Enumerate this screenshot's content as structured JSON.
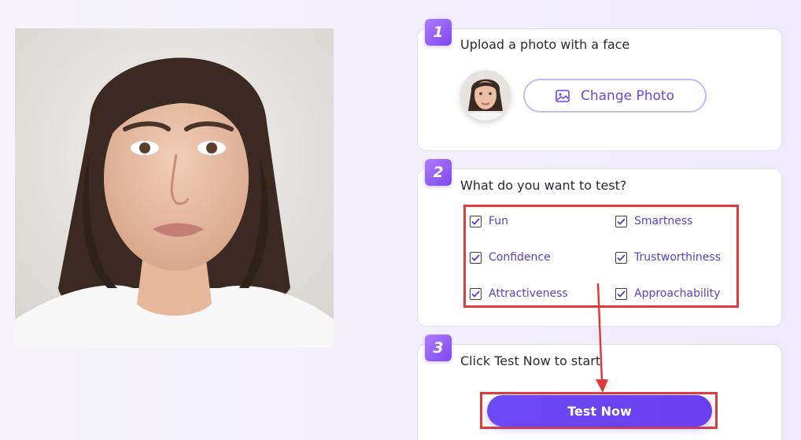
{
  "steps": [
    {
      "number": "1",
      "title": "Upload a photo with a face"
    },
    {
      "number": "2",
      "title": "What do you want to test?"
    },
    {
      "number": "3",
      "title": "Click Test Now to start"
    }
  ],
  "upload": {
    "change_label": "Change Photo",
    "button_icon": "image-icon"
  },
  "options": [
    {
      "label": "Fun",
      "checked": true
    },
    {
      "label": "Smartness",
      "checked": true
    },
    {
      "label": "Confidence",
      "checked": true
    },
    {
      "label": "Trustworthiness",
      "checked": true
    },
    {
      "label": "Attractiveness",
      "checked": true
    },
    {
      "label": "Approachability",
      "checked": true
    }
  ],
  "test_now_label": "Test Now",
  "colors": {
    "accent": "#6a3ff0",
    "highlight": "#e23a3a",
    "badge": "#8a55f5"
  }
}
